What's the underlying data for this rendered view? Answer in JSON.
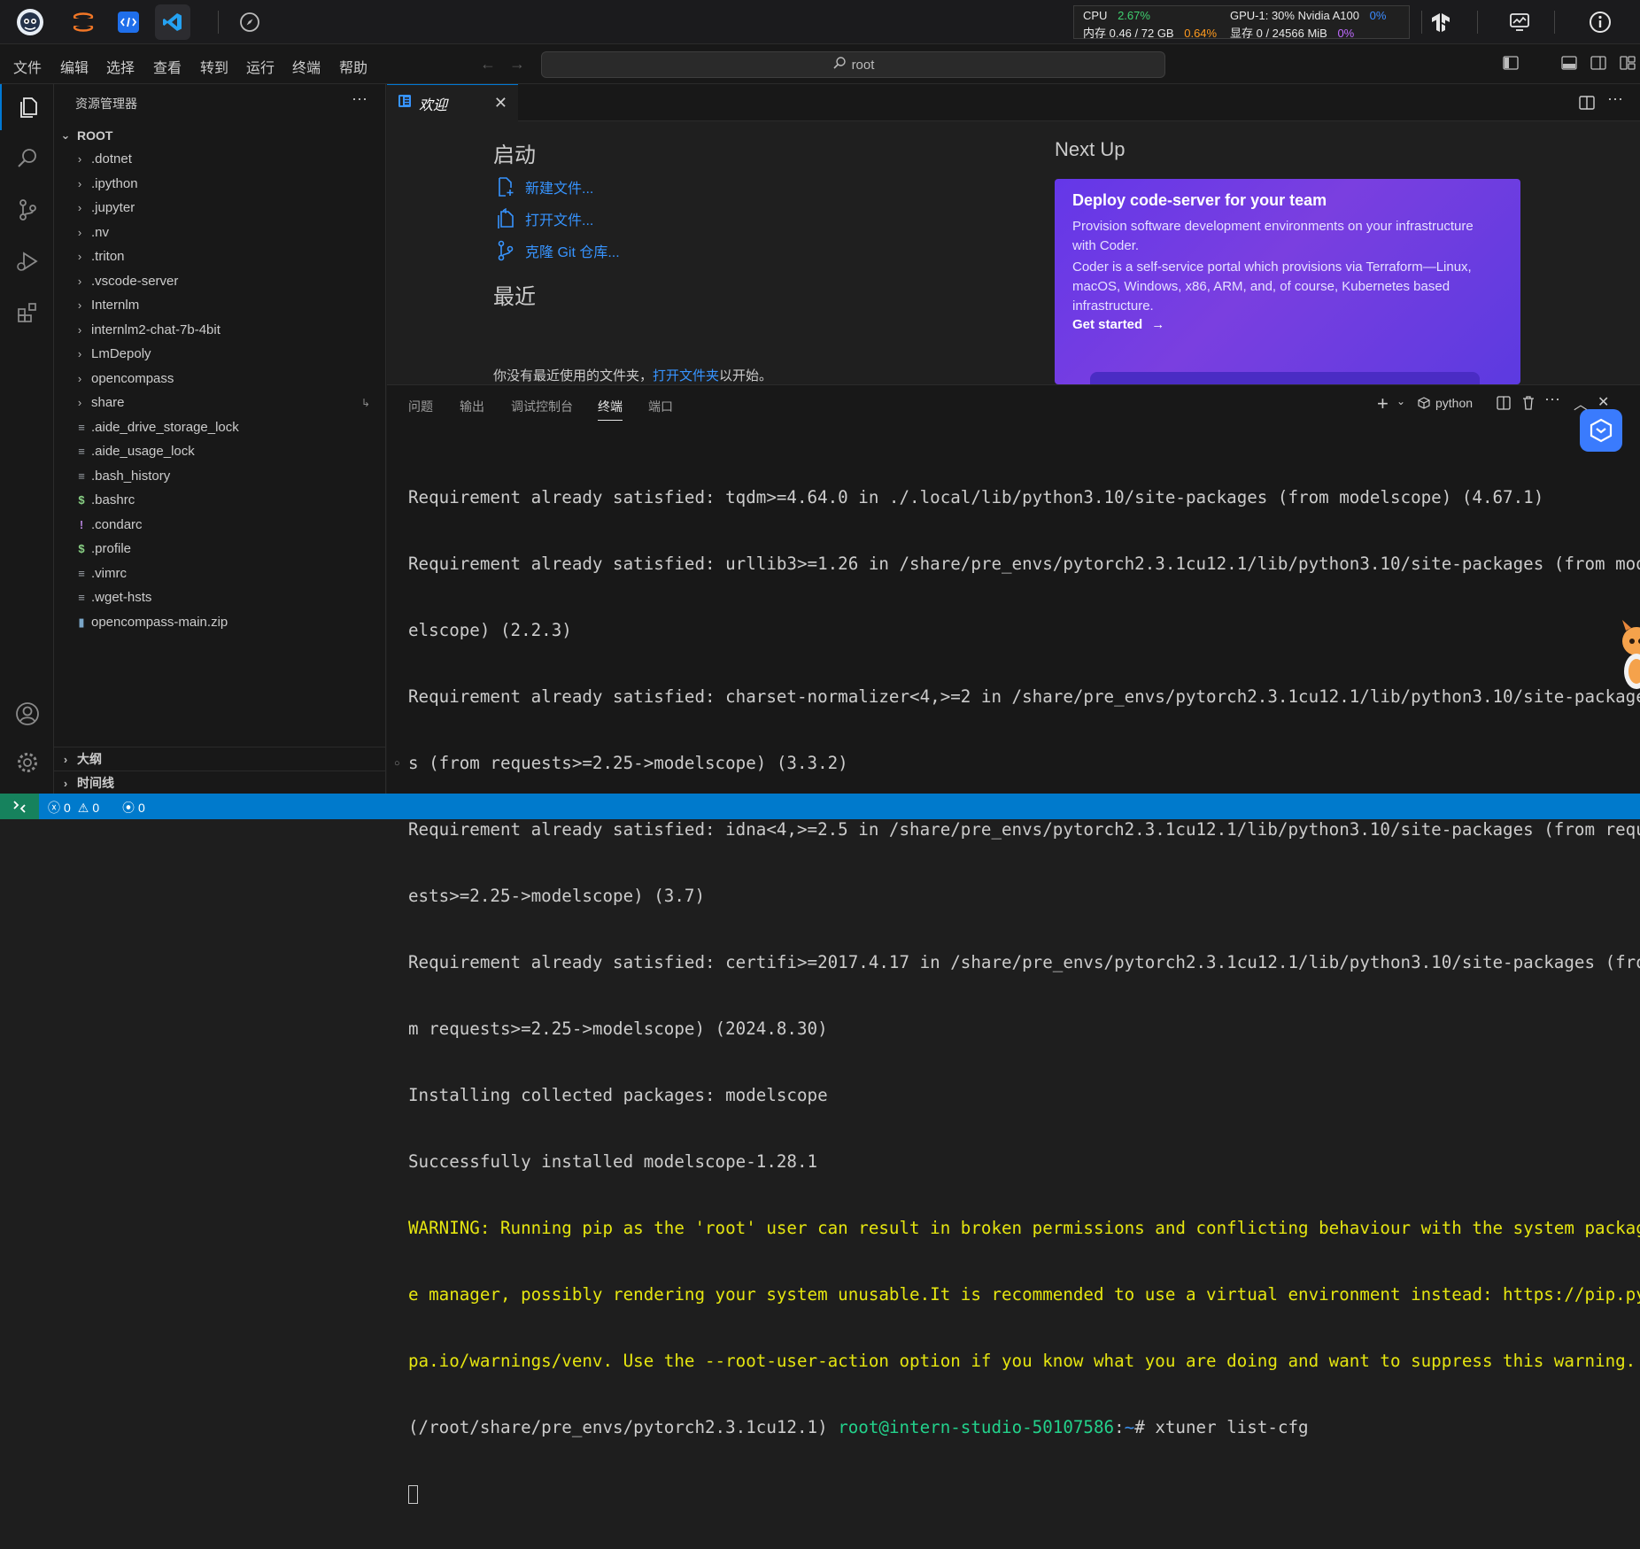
{
  "topbar": {
    "icons": [
      "mascot-logo",
      "jupyter-icon",
      "vscode-remote-icon",
      "vscode-icon",
      "compass-icon",
      "tensorflow-icon",
      "monitor-icon",
      "info-icon"
    ],
    "cpu_label": "CPU",
    "cpu_value": "2.67%",
    "mem_label": "内存 0.46 / 72 GB",
    "mem_value": "0.64%",
    "gpu_label": "GPU-1: 30% Nvidia A100",
    "gpu_value": "0%",
    "vram_label": "显存 0 / 24566 MiB",
    "vram_value": "0%"
  },
  "menubar": {
    "items": [
      "文件",
      "编辑",
      "选择",
      "查看",
      "转到",
      "运行",
      "终端",
      "帮助"
    ],
    "search_text": "root"
  },
  "sidebar": {
    "title": "资源管理器",
    "root_label": "ROOT",
    "folders": [
      ".dotnet",
      ".ipython",
      ".jupyter",
      ".nv",
      ".triton",
      ".vscode-server",
      "Internlm",
      "internlm2-chat-7b-4bit",
      "LmDepoly",
      "opencompass",
      "share"
    ],
    "files": [
      ".aide_drive_storage_lock",
      ".aide_usage_lock",
      ".bash_history",
      ".bashrc",
      ".condarc",
      ".profile",
      ".vimrc",
      ".wget-hsts",
      "opencompass-main.zip"
    ],
    "outline_label": "大纲",
    "timeline_label": "时间线"
  },
  "editor": {
    "tab_label": "欢迎",
    "start_title": "启动",
    "new_file": "新建文件...",
    "open_file": "打开文件...",
    "clone_git": "克隆 Git 仓库...",
    "recent_title": "最近",
    "recent_text": "你没有最近使用的文件夹，",
    "recent_link": "打开文件夹",
    "recent_suffix": "以开始。",
    "next_up": "Next Up",
    "card_title": "Deploy code-server for your team",
    "card_p1": "Provision software development environments on your infrastructure with Coder.",
    "card_p2": "Coder is a self-service portal which provisions via Terraform—Linux, macOS, Windows, x86, ARM, and, of course, Kubernetes based infrastructure.",
    "card_cta": "Get started"
  },
  "panel": {
    "tabs": [
      "问题",
      "输出",
      "调试控制台",
      "终端",
      "端口"
    ],
    "active_tab": "终端",
    "shell_label": "python"
  },
  "terminal": {
    "lines": [
      "Requirement already satisfied: tqdm>=4.64.0 in ./.local/lib/python3.10/site-packages (from modelscope) (4.67.1)",
      "Requirement already satisfied: urllib3>=1.26 in /share/pre_envs/pytorch2.3.1cu12.1/lib/python3.10/site-packages (from mod",
      "elscope) (2.2.3)",
      "Requirement already satisfied: charset-normalizer<4,>=2 in /share/pre_envs/pytorch2.3.1cu12.1/lib/python3.10/site-package",
      "s (from requests>=2.25->modelscope) (3.3.2)",
      "Requirement already satisfied: idna<4,>=2.5 in /share/pre_envs/pytorch2.3.1cu12.1/lib/python3.10/site-packages (from requ",
      "ests>=2.25->modelscope) (3.7)",
      "Requirement already satisfied: certifi>=2017.4.17 in /share/pre_envs/pytorch2.3.1cu12.1/lib/python3.10/site-packages (fro",
      "m requests>=2.25->modelscope) (2024.8.30)",
      "Installing collected packages: modelscope",
      "Successfully installed modelscope-1.28.1"
    ],
    "warning_lines": [
      "WARNING: Running pip as the 'root' user can result in broken permissions and conflicting behaviour with the system packag",
      "e manager, possibly rendering your system unusable.It is recommended to use a virtual environment instead: https://pip.py",
      "pa.io/warnings/venv. Use the --root-user-action option if you know what you are doing and want to suppress this warning."
    ],
    "prompt_env": "(/root/share/pre_envs/pytorch2.3.1cu12.1) ",
    "prompt_user": "root@intern-studio-50107586",
    "prompt_colon": ":",
    "prompt_tilde": "~",
    "prompt_hash": "# ",
    "command": "xtuner list-cfg"
  },
  "statusbar": {
    "errors": "0",
    "warnings": "0",
    "ports": "0"
  }
}
